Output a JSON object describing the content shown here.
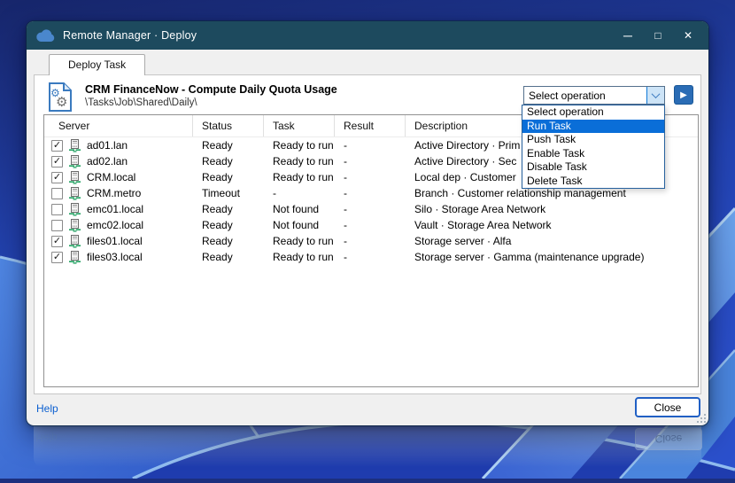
{
  "window": {
    "title": "Remote Manager · Deploy",
    "minimize_glyph": "─",
    "maximize_glyph": "□",
    "close_glyph": "✕"
  },
  "tabs": {
    "deploy": "Deploy Task"
  },
  "task_header": {
    "title": "CRM FinanceNow - Compute Daily Quota Usage",
    "path": "\\Tasks\\Job\\Shared\\Daily\\"
  },
  "operation": {
    "selected": "Select operation",
    "options": [
      {
        "label": "Select operation",
        "highlighted": false
      },
      {
        "label": "Run Task",
        "highlighted": true
      },
      {
        "label": "Push Task",
        "highlighted": false
      },
      {
        "label": "Enable Task",
        "highlighted": false
      },
      {
        "label": "Disable Task",
        "highlighted": false
      },
      {
        "label": "Delete Task",
        "highlighted": false
      }
    ]
  },
  "table": {
    "columns": [
      "Server",
      "Status",
      "Task",
      "Result",
      "Description"
    ],
    "rows": [
      {
        "checked": true,
        "server": "ad01.lan",
        "status": "Ready",
        "task": "Ready to run",
        "result": "-",
        "description": "Active Directory · Prim"
      },
      {
        "checked": true,
        "server": "ad02.lan",
        "status": "Ready",
        "task": "Ready to run",
        "result": "-",
        "description": "Active Directory · Sec"
      },
      {
        "checked": true,
        "server": "CRM.local",
        "status": "Ready",
        "task": "Ready to run",
        "result": "-",
        "description": "Local dep · Customer"
      },
      {
        "checked": false,
        "server": "CRM.metro",
        "status": "Timeout",
        "task": "-",
        "result": "-",
        "description": "Branch · Customer relationship management"
      },
      {
        "checked": false,
        "server": "emc01.local",
        "status": "Ready",
        "task": "Not found",
        "result": "-",
        "description": "Silo · Storage Area Network"
      },
      {
        "checked": false,
        "server": "emc02.local",
        "status": "Ready",
        "task": "Not found",
        "result": "-",
        "description": "Vault · Storage Area Network"
      },
      {
        "checked": true,
        "server": "files01.local",
        "status": "Ready",
        "task": "Ready to run",
        "result": "-",
        "description": "Storage server · Alfa"
      },
      {
        "checked": true,
        "server": "files03.local",
        "status": "Ready",
        "task": "Ready to run",
        "result": "-",
        "description": "Storage server · Gamma (maintenance upgrade)"
      }
    ]
  },
  "footer": {
    "help": "Help",
    "close": "Close"
  },
  "colors": {
    "titlebar": "#1d4a5e",
    "highlight_blue": "#0a6ed8",
    "run_button_blue": "#2a6cb5",
    "link_blue": "#0b5fd0",
    "server_icon_green": "#1fa05f"
  }
}
